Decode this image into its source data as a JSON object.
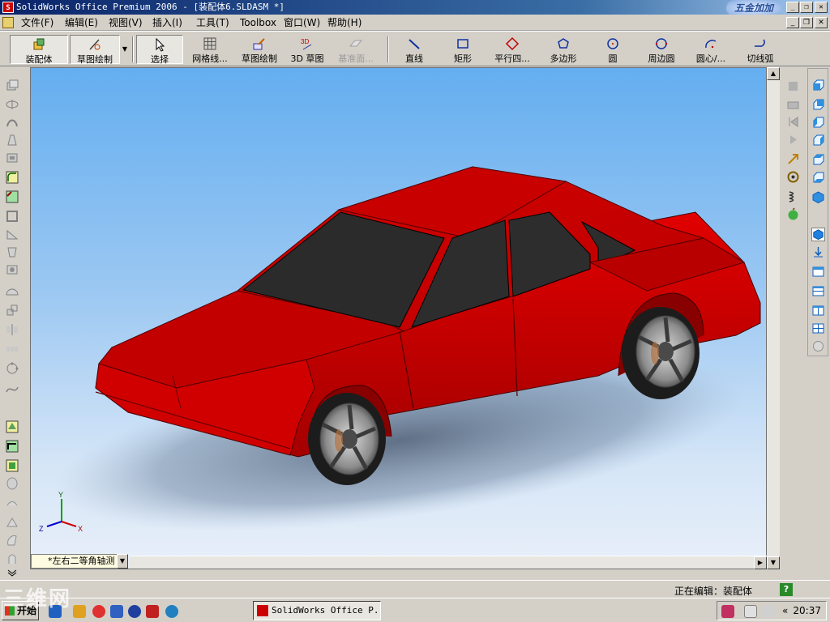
{
  "window": {
    "title": "SolidWorks Office Premium 2006 - [装配体6.SLDASM *]",
    "app_icon_text": "S",
    "brand_badge": "五金加加",
    "minimize": "_",
    "restore": "❐",
    "close": "✕"
  },
  "menu": {
    "items": [
      "文件(F)",
      "编辑(E)",
      "视图(V)",
      "插入(I)",
      "工具(T)",
      "Toolbox",
      "窗口(W)",
      "帮助(H)"
    ]
  },
  "toolbar": {
    "assembly": "装配体",
    "sketch_draw": "草图绘制",
    "select": "选择",
    "grid": "网格线...",
    "sketch_draw2": "草图绘制",
    "sketch3d": "3D 草图",
    "datum_plane": "基准面...",
    "line": "直线",
    "rect": "矩形",
    "parallelogram": "平行四...",
    "polygon": "多边形",
    "circle": "圆",
    "perimeter_circle": "周边圆",
    "center_arc": "圆心/...",
    "tangent_arc": "切线弧"
  },
  "viewport": {
    "view_name": "*左右二等角轴测",
    "axis_x": "X",
    "axis_y": "Y",
    "axis_z": "Z",
    "colors": {
      "body": "#cc0000",
      "body_dark": "#8a0000",
      "glass": "#2b2b2b",
      "tire": "#1c1c1c",
      "rim": "#9a9a9a"
    }
  },
  "statusbar": {
    "editing": "正在编辑：装配体",
    "help": "?"
  },
  "taskbar": {
    "start": "开始",
    "task_button": "SolidWorks Office P...",
    "chevron": "«",
    "clock": "20:37"
  },
  "watermark": "三维网"
}
